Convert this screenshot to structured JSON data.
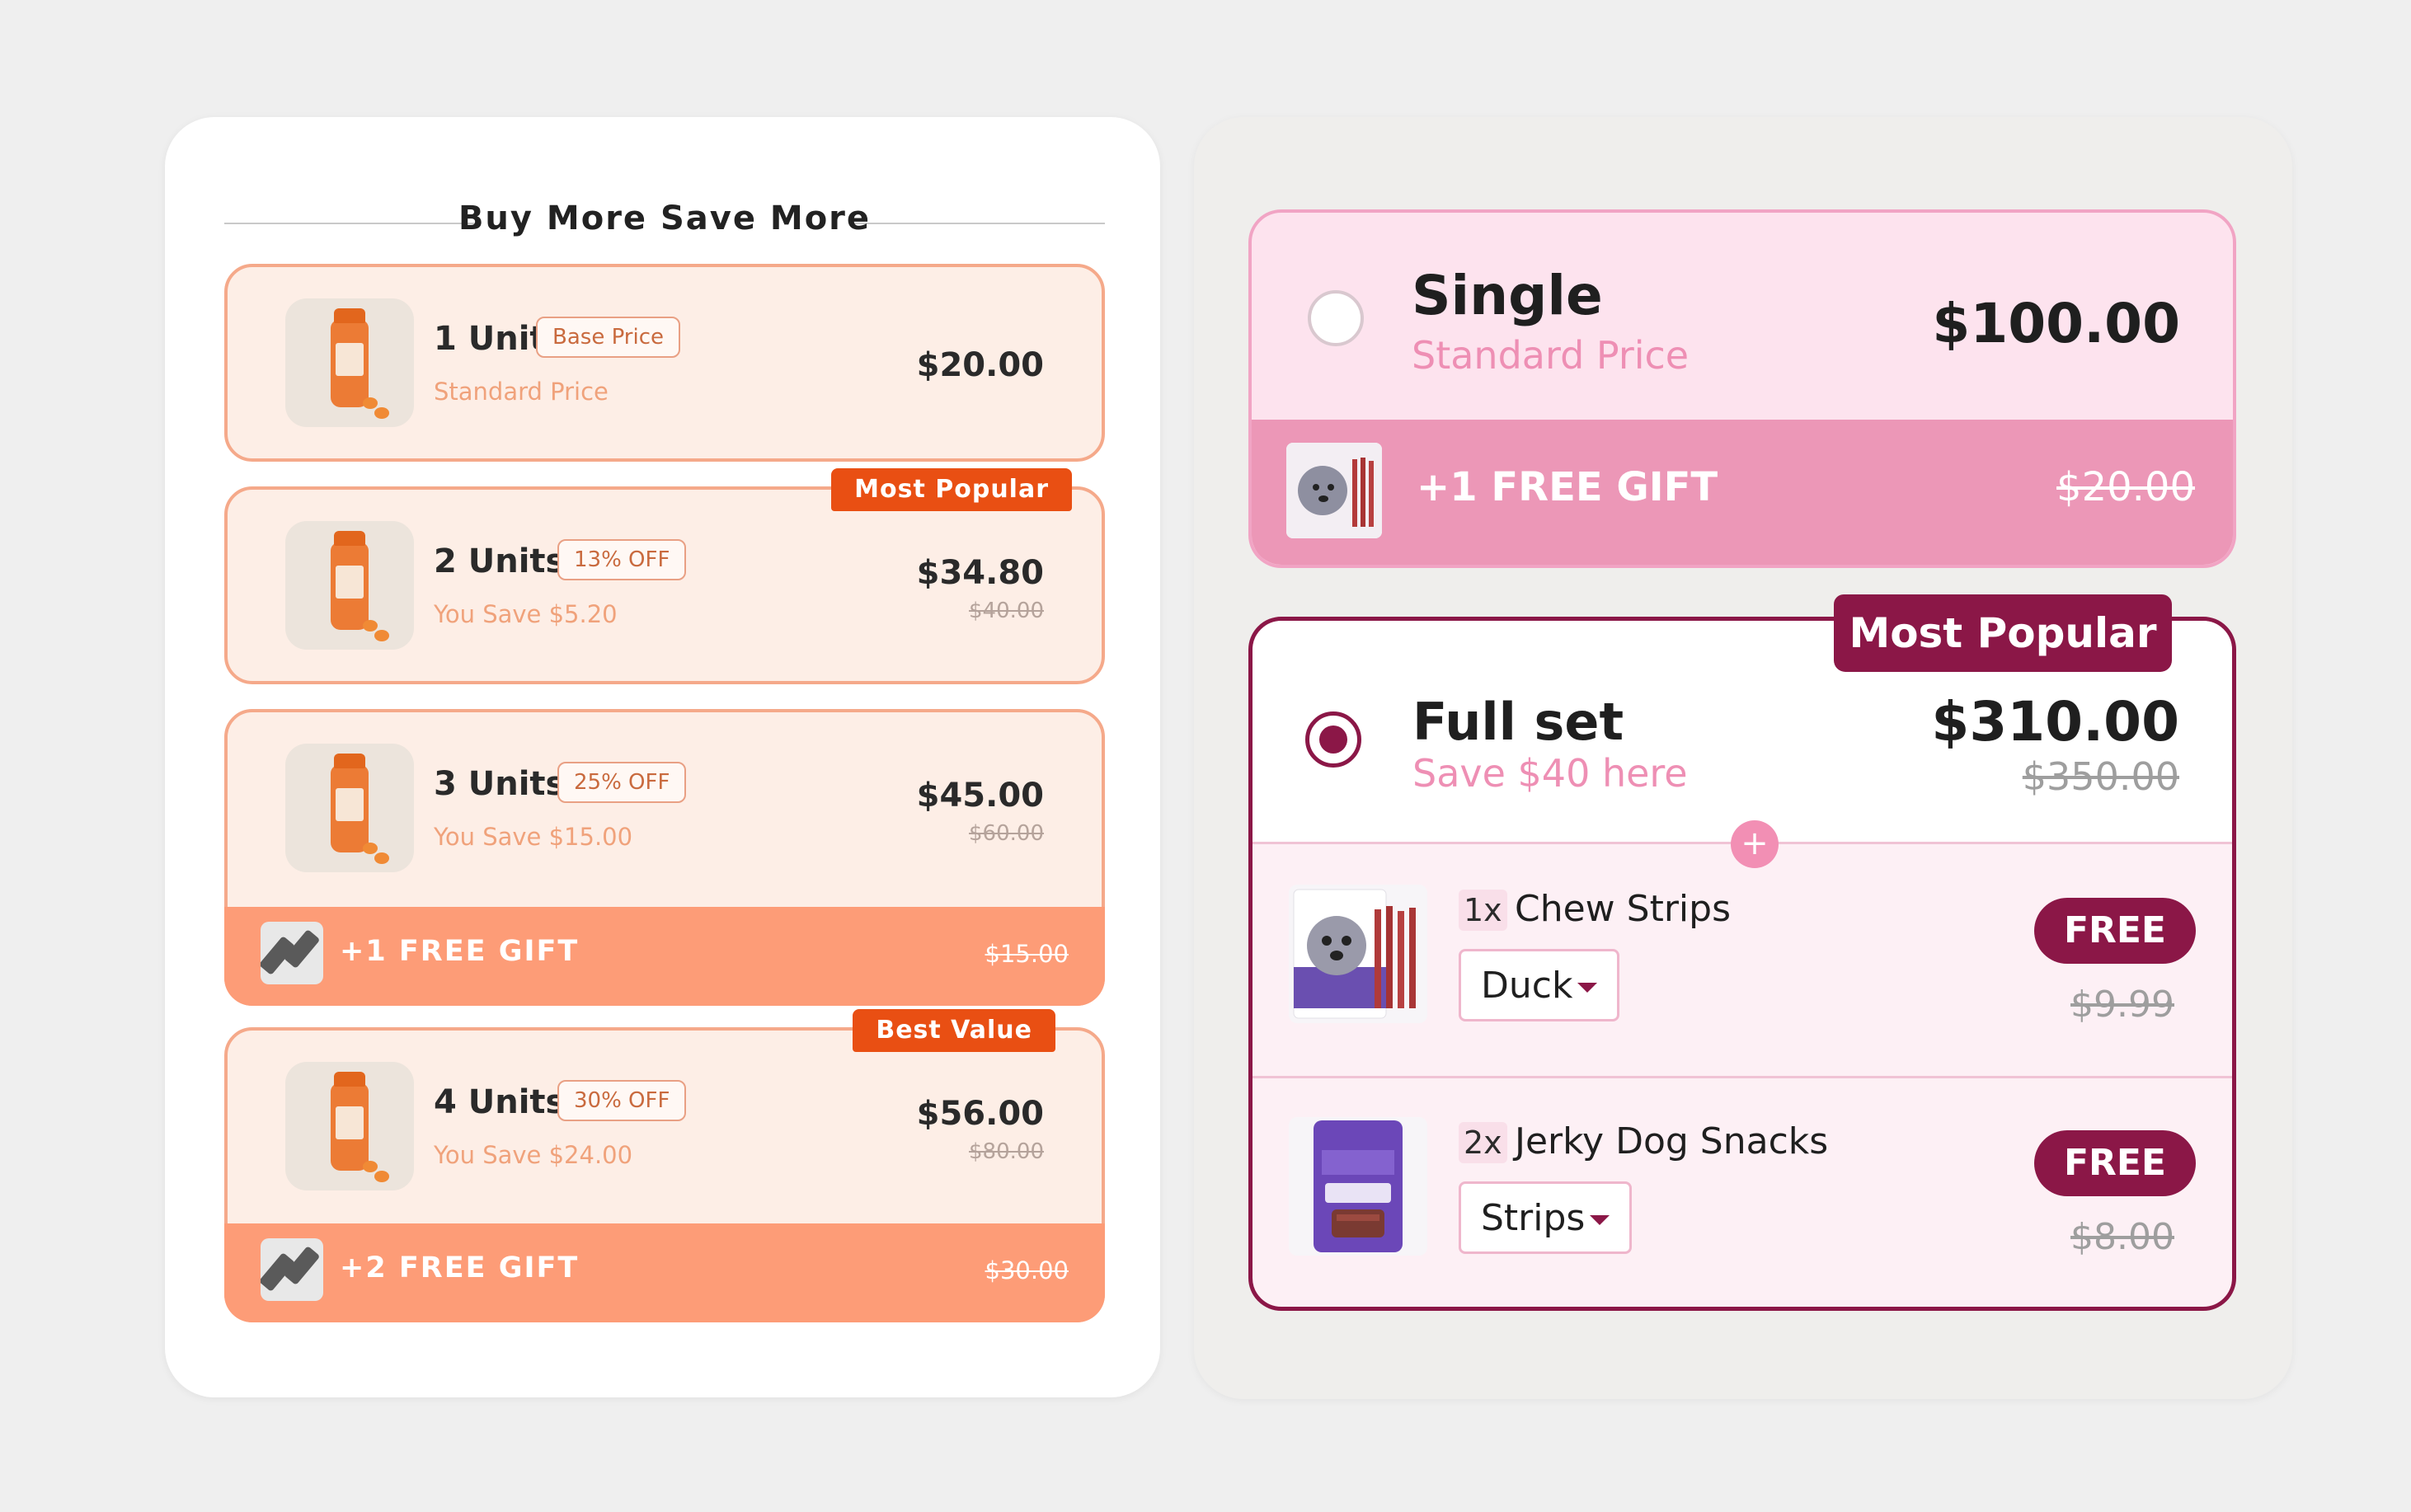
{
  "left": {
    "header": "Buy More Save More",
    "tiers": [
      {
        "name": "1 Unit",
        "chip": "Base Price",
        "sub": "Standard Price",
        "price": "$20.00",
        "was": "",
        "ribbon": "",
        "gift": "",
        "gift_was": ""
      },
      {
        "name": "2 Units",
        "chip": "13% OFF",
        "sub": "You Save $5.20",
        "price": "$34.80",
        "was": "$40.00",
        "ribbon": "Most Popular",
        "gift": "",
        "gift_was": ""
      },
      {
        "name": "3 Units",
        "chip": "25% OFF",
        "sub": "You Save $15.00",
        "price": "$45.00",
        "was": "$60.00",
        "ribbon": "",
        "gift": "+1 FREE GIFT",
        "gift_was": "$15.00"
      },
      {
        "name": "4 Units",
        "chip": "30% OFF",
        "sub": "You Save $24.00",
        "price": "$56.00",
        "was": "$80.00",
        "ribbon": "Best Value",
        "gift": "+2 FREE GIFT",
        "gift_was": "$30.00"
      }
    ]
  },
  "right": {
    "single": {
      "title": "Single",
      "sub": "Standard Price",
      "price": "$100.00",
      "gift": "+1 FREE GIFT",
      "gift_was": "$20.00",
      "selected": false
    },
    "full": {
      "ribbon": "Most Popular",
      "title": "Full set",
      "sub": "Save $40 here",
      "price": "$310.00",
      "was": "$350.00",
      "plus": "+",
      "selected": true,
      "items": [
        {
          "qty": "1x",
          "name": "Chew Strips",
          "variant": "Duck",
          "tag": "FREE",
          "was": "$9.99"
        },
        {
          "qty": "2x",
          "name": "Jerky Dog Snacks",
          "variant": "Strips",
          "tag": "FREE",
          "was": "$8.00"
        }
      ]
    }
  },
  "colors": {
    "orange_accent": "#e94f13",
    "orange_gift_bar": "#fd9c77",
    "pink_accent": "#8b1747",
    "pink_light": "#fde3ee"
  }
}
